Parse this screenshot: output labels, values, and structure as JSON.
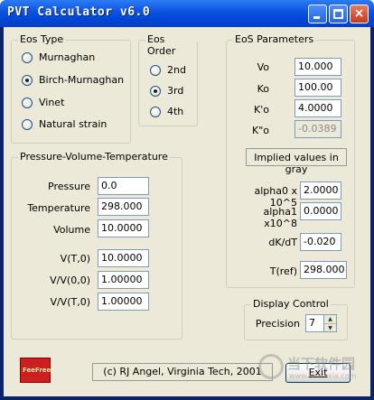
{
  "window": {
    "title": "PVT Calculator v6.0"
  },
  "eos_type": {
    "label": "Eos Type",
    "options": [
      "Murnaghan",
      "Birch-Murnaghan",
      "Vinet",
      "Natural strain"
    ],
    "selected": "Birch-Murnaghan"
  },
  "eos_order": {
    "label": "Eos Order",
    "options": [
      "2nd",
      "3rd",
      "4th"
    ],
    "selected": "3rd"
  },
  "eos_params": {
    "label": "EoS Parameters",
    "fields": [
      {
        "label": "Vo",
        "value": "10.000"
      },
      {
        "label": "Ko",
        "value": "100.00"
      },
      {
        "label": "K'o",
        "value": "4.0000"
      },
      {
        "label": "K\"o",
        "value": "-0.0389"
      }
    ],
    "implied_note": "Implied values in gray",
    "thermal": [
      {
        "label": "alpha0 x 10^5",
        "value": "2.0000"
      },
      {
        "label": "alpha1 x10^8",
        "value": "0.0000"
      },
      {
        "label": "dK/dT",
        "value": "-0.020"
      },
      {
        "label": "T(ref)",
        "value": "298.000"
      }
    ]
  },
  "pvt": {
    "label": "Pressure-Volume-Temperature",
    "inputs": [
      {
        "label": "Pressure",
        "value": "0.0"
      },
      {
        "label": "Temperature",
        "value": "298.000"
      },
      {
        "label": "Volume",
        "value": "10.0000"
      }
    ],
    "outputs": [
      {
        "label": "V(T,0)",
        "value": "10.0000"
      },
      {
        "label": "V/V(0,0)",
        "value": "1.00000"
      },
      {
        "label": "V/V(T,0)",
        "value": "1.00000"
      }
    ]
  },
  "display_control": {
    "label": "Display Control",
    "precision_label": "Precision",
    "precision_value": "7"
  },
  "footer": {
    "logo_text": "FeeFree",
    "copyright": "(c) RJ Angel, Virginia Tech, 2001",
    "exit_label": "Exit"
  },
  "watermark": {
    "line1": "当下软件园",
    "line2": "www.downxia.com"
  },
  "colors": {
    "titlebar": "#0a52e0",
    "client": "#ece9d8",
    "close": "#c8391b"
  }
}
